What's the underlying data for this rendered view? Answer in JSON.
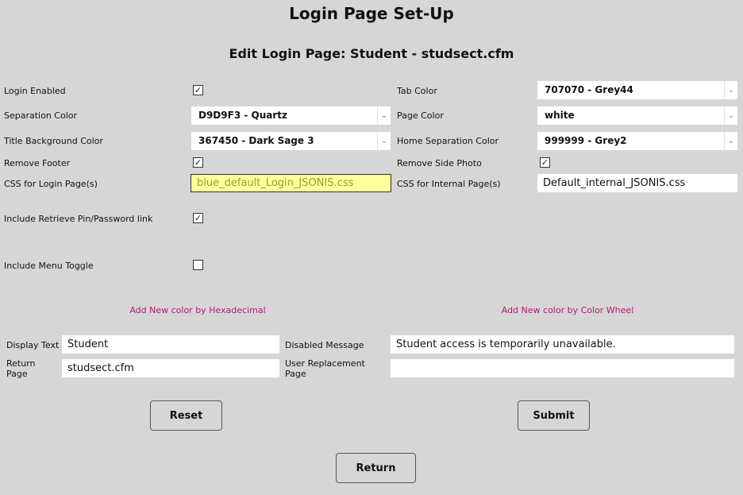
{
  "page": {
    "title": "Login Page Set-Up",
    "subtitle": "Edit Login Page: Student - studsect.cfm"
  },
  "left": {
    "login_enabled": {
      "label": "Login Enabled",
      "checked": true
    },
    "separation_color": {
      "label": "Separation Color",
      "value": "D9D9F3 - Quartz"
    },
    "title_background_color": {
      "label": "Title Background Color",
      "value": "367450 - Dark Sage 3"
    },
    "remove_footer": {
      "label": "Remove Footer",
      "checked": true
    },
    "css_login": {
      "label": "CSS for Login Page(s)",
      "value": "blue_default_Login_JSONIS.css"
    },
    "retrieve_pin": {
      "label": "Include Retrieve Pin/Password link",
      "checked": true
    },
    "menu_toggle": {
      "label": "Include Menu Toggle",
      "checked": false
    }
  },
  "right": {
    "tab_color": {
      "label": "Tab Color",
      "value": "707070 - Grey44"
    },
    "page_color": {
      "label": "Page Color",
      "value": "white"
    },
    "home_separation_color": {
      "label": "Home Separation Color",
      "value": "999999 - Grey2"
    },
    "remove_side_photo": {
      "label": "Remove Side Photo",
      "checked": true
    },
    "css_internal": {
      "label": "CSS for Internal Page(s)",
      "value": "Default_internal_JSONIS.css"
    }
  },
  "links": {
    "hex": "Add New color by Hexadecimal",
    "wheel": "Add New color by Color Wheel"
  },
  "bottom": {
    "display_text": {
      "label": "Display Text",
      "value": "Student"
    },
    "return_page": {
      "label": "Return Page",
      "value": "studsect.cfm"
    },
    "disabled_message": {
      "label": "Disabled Message",
      "value": "Student access is temporarily unavailable."
    },
    "user_replacement_page": {
      "label": "User Replacement Page",
      "value": ""
    }
  },
  "buttons": {
    "reset": "Reset",
    "submit": "Submit",
    "return": "Return"
  },
  "icons": {
    "checkmark": "✓",
    "chevron": "⌄"
  },
  "colors": {
    "background": "#d6d6d6",
    "link": "#b5177a",
    "highlight": "#ffff9e"
  }
}
